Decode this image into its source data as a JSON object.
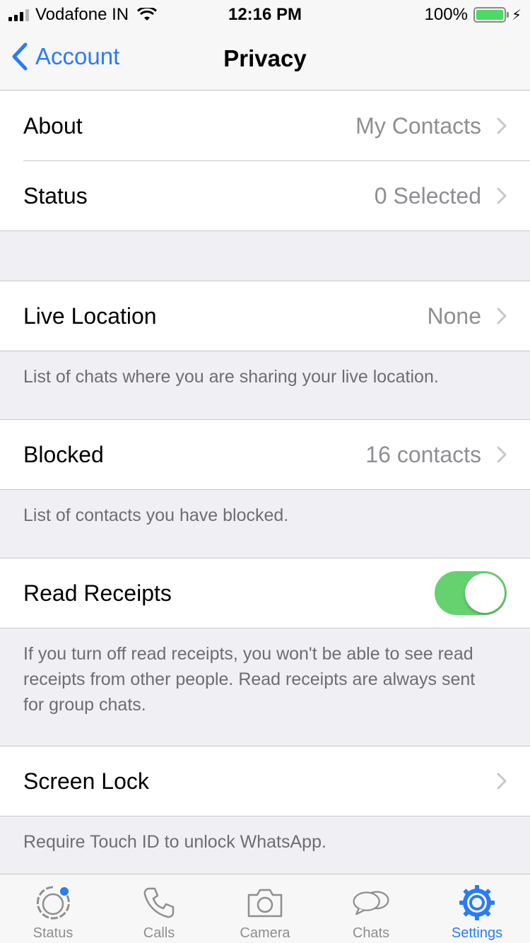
{
  "statusbar": {
    "carrier": "Vodafone IN",
    "time": "12:16 PM",
    "battery": "100%"
  },
  "nav": {
    "back_label": "Account",
    "title": "Privacy"
  },
  "rows": {
    "about": {
      "label": "About",
      "value": "My Contacts"
    },
    "status": {
      "label": "Status",
      "value": "0 Selected"
    },
    "live_location": {
      "label": "Live Location",
      "value": "None",
      "footer": "List of chats where you are sharing your live location."
    },
    "blocked": {
      "label": "Blocked",
      "value": "16 contacts",
      "footer": "List of contacts you have blocked."
    },
    "read_receipts": {
      "label": "Read Receipts",
      "enabled": true,
      "footer": "If you turn off read receipts, you won't be able to see read receipts from other people. Read receipts are always sent for group chats."
    },
    "screen_lock": {
      "label": "Screen Lock",
      "footer": "Require Touch ID to unlock WhatsApp."
    }
  },
  "tabs": [
    {
      "label": "Status",
      "icon": "status-icon"
    },
    {
      "label": "Calls",
      "icon": "phone-icon"
    },
    {
      "label": "Camera",
      "icon": "camera-icon"
    },
    {
      "label": "Chats",
      "icon": "chats-icon"
    },
    {
      "label": "Settings",
      "icon": "gear-icon",
      "active": true
    }
  ],
  "colors": {
    "accent": "#2a7cf6",
    "toggle_on": "#65d16f",
    "battery": "#4cd964",
    "background": "#efeff4"
  }
}
